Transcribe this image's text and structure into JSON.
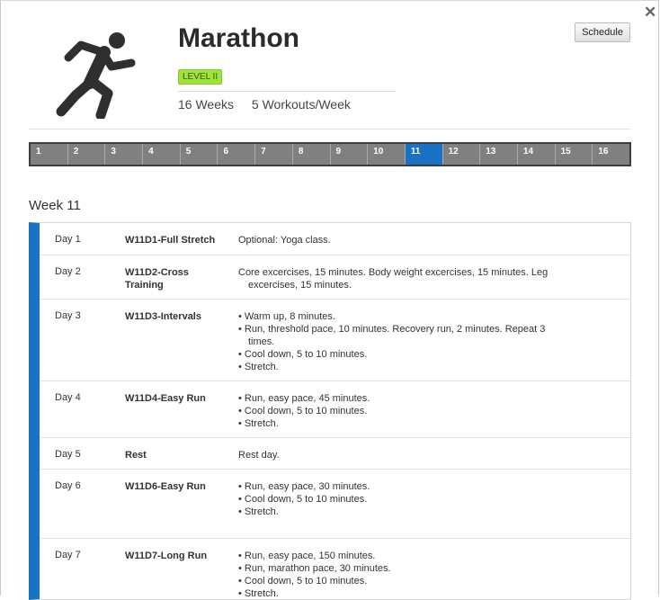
{
  "close_icon": "close-icon",
  "program": {
    "title": "Marathon",
    "level": "LEVEL II",
    "duration": "16 Weeks",
    "frequency": "5 Workouts/Week",
    "icon": "runner-icon"
  },
  "schedule_button": "Schedule",
  "weeks": [
    "1",
    "2",
    "3",
    "4",
    "5",
    "6",
    "7",
    "8",
    "9",
    "10",
    "11",
    "12",
    "13",
    "14",
    "15",
    "16"
  ],
  "active_week": "11",
  "colors": {
    "accent": "#1a72c4",
    "level_badge": "#9ee43a",
    "week_bar": "#808080"
  },
  "week_title": "Week 11",
  "days": [
    {
      "day": "Day 1",
      "workout": "W11D1-Full Stretch",
      "lines": [
        "Optional: Yoga class."
      ],
      "bulleted": false
    },
    {
      "day": "Day 2",
      "workout": "W11D2-Cross Training",
      "lines": [
        "Core excercises, 15 minutes. Body weight excercises, 15 minutes. Leg excercises, 15 minutes."
      ],
      "bulleted": false
    },
    {
      "day": "Day 3",
      "workout": "W11D3-Intervals",
      "lines": [
        "• Warm up, 8 minutes.",
        "• Run, threshold pace, 10 minutes. Recovery run, 2 minutes. Repeat 3 times.",
        "• Cool down, 5 to 10 minutes.",
        "• Stretch."
      ],
      "bulleted": true
    },
    {
      "day": "Day 4",
      "workout": "W11D4-Easy Run",
      "lines": [
        "• Run, easy pace, 45 minutes.",
        "• Cool down, 5 to 10 minutes.",
        "• Stretch."
      ],
      "bulleted": true
    },
    {
      "day": "Day 5",
      "workout": "Rest",
      "lines": [
        "Rest day."
      ],
      "bulleted": false
    },
    {
      "day": "Day 6",
      "workout": "W11D6-Easy Run",
      "lines": [
        "• Run, easy pace, 30 minutes.",
        "• Cool down, 5 to 10 minutes.",
        "• Stretch."
      ],
      "bulleted": true
    },
    {
      "day": "Day 7",
      "workout": "W11D7-Long Run",
      "lines": [
        "• Run, easy pace, 150 minutes.",
        "• Run, marathon pace, 30 minutes.",
        "• Cool down, 5 to 10 minutes.",
        "• Stretch."
      ],
      "bulleted": true
    }
  ]
}
